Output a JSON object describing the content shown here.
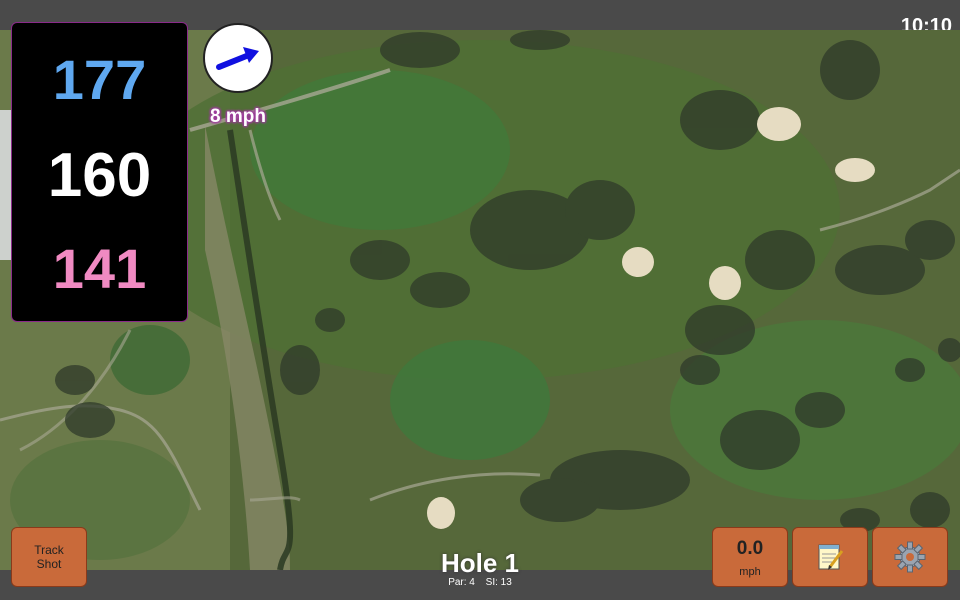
{
  "status": {
    "time": "10:10"
  },
  "distances": {
    "back": "177",
    "middle": "160",
    "front": "141"
  },
  "wind": {
    "speed_label": "8 mph",
    "direction_icon": "arrow-icon"
  },
  "track_button": {
    "label_line1": "Track",
    "label_line2": "Shot"
  },
  "speed_button": {
    "value": "0.0",
    "unit": "mph"
  },
  "notes_button": {
    "icon": "notepad-icon"
  },
  "settings_button": {
    "icon": "gear-icon"
  },
  "hole": {
    "title": "Hole 1",
    "par": "Par: 4",
    "stroke_index": "SI: 13"
  },
  "colors": {
    "back": "#5fa8f0",
    "middle": "#ffffff",
    "front": "#f08ac2",
    "button": "#c96a3a",
    "bar": "#4a4a4a"
  }
}
